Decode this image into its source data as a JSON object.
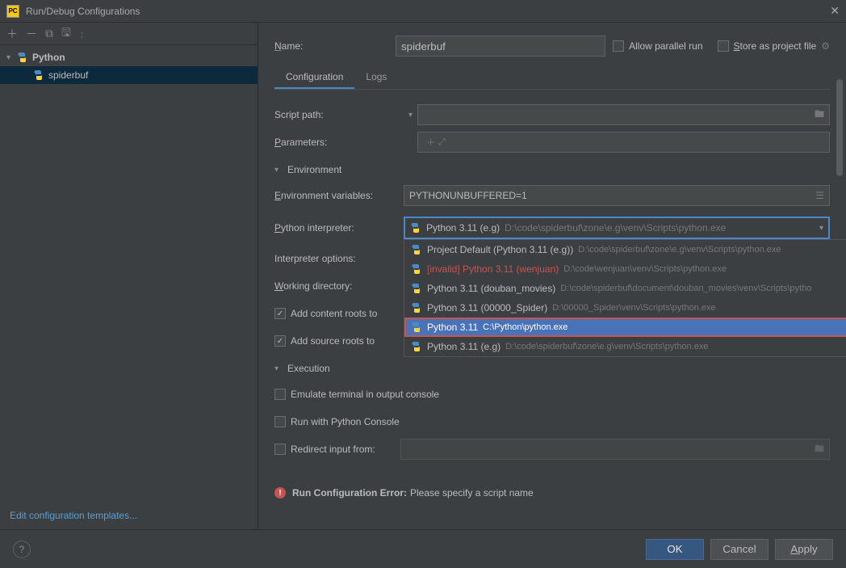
{
  "titlebar": {
    "title": "Run/Debug Configurations"
  },
  "sidebar": {
    "toolbar_icons": [
      "add",
      "remove",
      "copy",
      "save",
      "sort"
    ],
    "tree": {
      "root_label": "Python",
      "items": [
        "spiderbuf"
      ]
    },
    "edit_templates": "Edit configuration templates..."
  },
  "form": {
    "name_label": "Name:",
    "name_value": "spiderbuf",
    "allow_parallel_label": "Allow parallel run",
    "allow_parallel_checked": false,
    "store_label": "Store as project file",
    "store_checked": false,
    "tabs": [
      {
        "label": "Configuration",
        "active": true
      },
      {
        "label": "Logs",
        "active": false
      }
    ],
    "script_path_label": "Script path:",
    "script_path_value": "",
    "parameters_label": "Parameters:",
    "parameters_value": "",
    "env_section": "Environment",
    "env_vars_label": "Environment variables:",
    "env_vars_value": "PYTHONUNBUFFERED=1",
    "interpreter_label": "Python interpreter:",
    "interpreter_selected_name": "Python 3.11 (e.g)",
    "interpreter_selected_path": "D:\\code\\spiderbuf\\zone\\e.g\\venv\\Scripts\\python.exe",
    "interpreter_options_label": "Interpreter options:",
    "working_dir_label": "Working directory:",
    "add_content_roots_label": "Add content roots to",
    "add_content_roots_checked": true,
    "add_source_roots_label": "Add source roots to",
    "add_source_roots_checked": true,
    "exec_section": "Execution",
    "emulate_label": "Emulate terminal in output console",
    "emulate_checked": false,
    "python_console_label": "Run with Python Console",
    "python_console_checked": false,
    "redirect_label": "Redirect input from:",
    "redirect_checked": false,
    "redirect_value": ""
  },
  "interpreter_dropdown": [
    {
      "name": "Project Default (Python 3.11 (e.g))",
      "path": "D:\\code\\spiderbuf\\zone\\e.g\\venv\\Scripts\\python.exe",
      "invalid": false,
      "highlighted": false,
      "boxed": false
    },
    {
      "name": "[invalid] Python 3.11 (wenjuan)",
      "path": "D:\\code\\wenjuan\\venv\\Scripts\\python.exe",
      "invalid": true,
      "highlighted": false,
      "boxed": false
    },
    {
      "name": "Python 3.11 (douban_movies)",
      "path": "D:\\code\\spiderbuf\\document\\douban_movies\\venv\\Scripts\\pytho",
      "invalid": false,
      "highlighted": false,
      "boxed": false
    },
    {
      "name": "Python 3.11 (00000_Spider)",
      "path": "D:\\00000_Spider\\venv\\Scripts\\python.exe",
      "invalid": false,
      "highlighted": false,
      "boxed": false
    },
    {
      "name": "Python 3.11",
      "path": "C:\\Python\\python.exe",
      "invalid": false,
      "highlighted": true,
      "boxed": true
    },
    {
      "name": "Python 3.11 (e.g)",
      "path": "D:\\code\\spiderbuf\\zone\\e.g\\venv\\Scripts\\python.exe",
      "invalid": false,
      "highlighted": false,
      "boxed": false
    }
  ],
  "error": {
    "label": "Run Configuration Error:",
    "message": "Please specify a script name"
  },
  "footer": {
    "ok": "OK",
    "cancel": "Cancel",
    "apply": "Apply"
  }
}
